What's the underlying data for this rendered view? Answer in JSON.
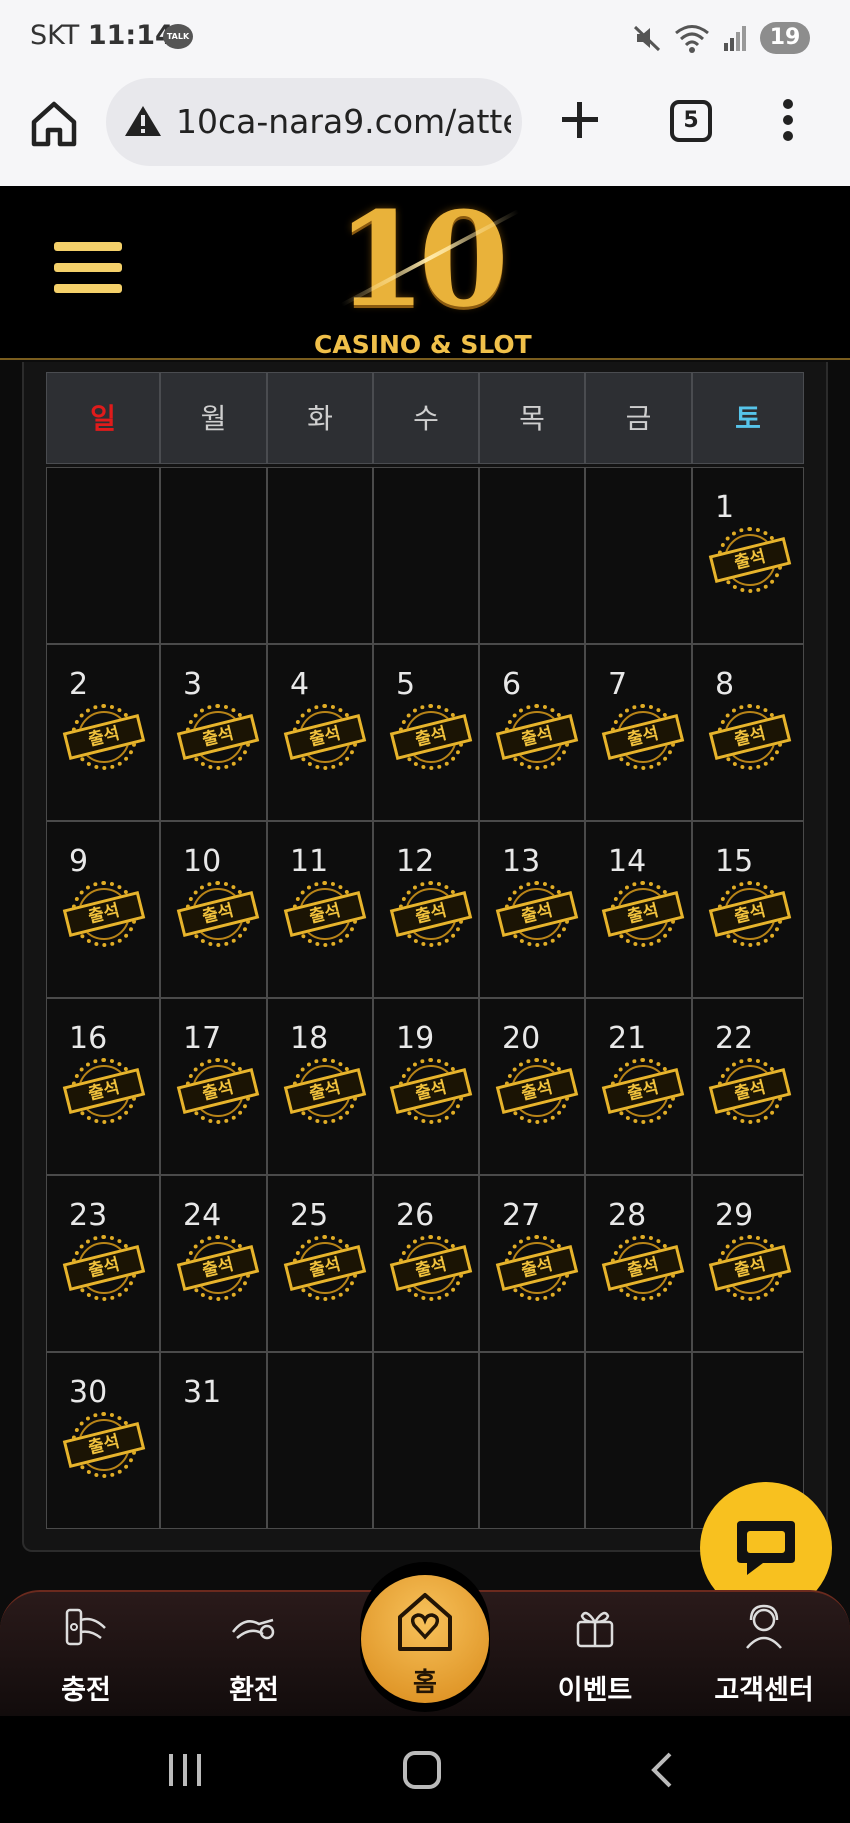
{
  "status_bar": {
    "carrier": "SKT",
    "time": "11:14",
    "talk_badge": "TALK",
    "battery": "19",
    "icons": [
      "mute-icon",
      "wifi-icon",
      "signal-icon",
      "battery-icon"
    ]
  },
  "browser": {
    "url": "10ca-nara9.com/atte",
    "tab_count": "5",
    "icons": [
      "home-icon",
      "warning-icon",
      "plus-icon",
      "tabs-icon",
      "overflow-menu-icon"
    ]
  },
  "site": {
    "logo_number": "10",
    "logo_text": "CASINO & SLOT"
  },
  "calendar": {
    "weekdays": [
      "일",
      "월",
      "화",
      "수",
      "목",
      "금",
      "토"
    ],
    "stamp_label": "출석",
    "weeks": [
      [
        null,
        null,
        null,
        null,
        null,
        null,
        {
          "day": "1",
          "stamp": true
        }
      ],
      [
        {
          "day": "2",
          "stamp": true
        },
        {
          "day": "3",
          "stamp": true
        },
        {
          "day": "4",
          "stamp": true
        },
        {
          "day": "5",
          "stamp": true
        },
        {
          "day": "6",
          "stamp": true
        },
        {
          "day": "7",
          "stamp": true
        },
        {
          "day": "8",
          "stamp": true
        }
      ],
      [
        {
          "day": "9",
          "stamp": true
        },
        {
          "day": "10",
          "stamp": true
        },
        {
          "day": "11",
          "stamp": true
        },
        {
          "day": "12",
          "stamp": true
        },
        {
          "day": "13",
          "stamp": true
        },
        {
          "day": "14",
          "stamp": true
        },
        {
          "day": "15",
          "stamp": true
        }
      ],
      [
        {
          "day": "16",
          "stamp": true
        },
        {
          "day": "17",
          "stamp": true
        },
        {
          "day": "18",
          "stamp": true
        },
        {
          "day": "19",
          "stamp": true
        },
        {
          "day": "20",
          "stamp": true
        },
        {
          "day": "21",
          "stamp": true
        },
        {
          "day": "22",
          "stamp": true
        }
      ],
      [
        {
          "day": "23",
          "stamp": true
        },
        {
          "day": "24",
          "stamp": true
        },
        {
          "day": "25",
          "stamp": true
        },
        {
          "day": "26",
          "stamp": true
        },
        {
          "day": "27",
          "stamp": true
        },
        {
          "day": "28",
          "stamp": true
        },
        {
          "day": "29",
          "stamp": true
        }
      ],
      [
        {
          "day": "30",
          "stamp": true
        },
        {
          "day": "31",
          "stamp": false
        },
        null,
        null,
        null,
        null,
        null
      ]
    ]
  },
  "bottom_nav": {
    "items": [
      {
        "label": "충전",
        "icon": "deposit-icon"
      },
      {
        "label": "환전",
        "icon": "withdraw-icon"
      },
      {
        "label": "홈",
        "icon": "home-heart-icon"
      },
      {
        "label": "이벤트",
        "icon": "gift-icon"
      },
      {
        "label": "고객센터",
        "icon": "support-icon"
      }
    ]
  },
  "colors": {
    "gold": "#e9b23a",
    "sunday": "#e01b1b",
    "saturday": "#56c4ea",
    "chat_fab": "#f8c11f"
  }
}
